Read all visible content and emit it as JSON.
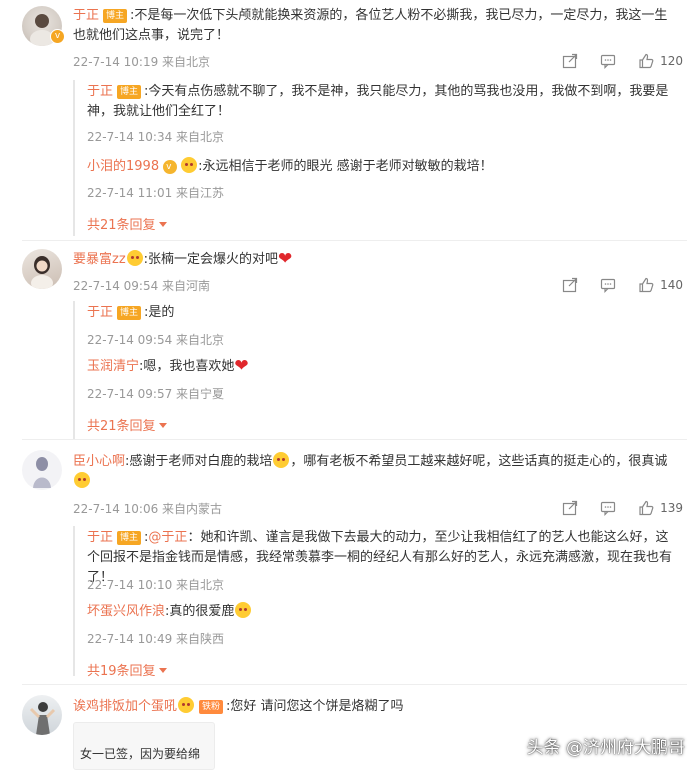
{
  "colors": {
    "accent": "#eb7350",
    "meta": "#999999",
    "badge": "#f6a623"
  },
  "comments": [
    {
      "user": "于正",
      "badge": "博主",
      "text": ":不是每一次低下头颅就能换来资源的，各位艺人粉不必撕我，我已尽力，一定尽力，我这一生也就他们这点事，说完了！",
      "time": "22-7-14 10:19 来自北京",
      "likes": "120",
      "replies": [
        {
          "user": "于正",
          "badge": "博主",
          "text": ":今天有点伤感就不聊了，我不是神，我只能尽力，其他的骂我也没用，我做不到啊，我要是神，我就让他们全红了！",
          "time": "22-7-14 10:34 来自北京"
        },
        {
          "user": "小泪的1998",
          "text": ":永远相信于老师的眼光 感谢于老师对敏敏的栽培！",
          "time": "22-7-14 11:01 来自江苏"
        }
      ],
      "more": "共21条回复"
    },
    {
      "user": "要暴富zz",
      "text": ":张楠一定会爆火的对吧",
      "time": "22-7-14 09:54 来自河南",
      "likes": "140",
      "replies": [
        {
          "user": "于正",
          "badge": "博主",
          "text": ":是的",
          "time": "22-7-14 09:54 来自北京"
        },
        {
          "user": "玉润清宁",
          "text": ":嗯，我也喜欢她",
          "time": "22-7-14 09:57 来自宁夏"
        }
      ],
      "more": "共21条回复"
    },
    {
      "user": "臣小心啊",
      "text": ":感谢于老师对白鹿的栽培",
      "text2": "，哪有老板不希望员工越来越好呢，这些话真的挺走心的，很真诚",
      "time": "22-7-14 10:06 来自内蒙古",
      "likes": "139",
      "replies": [
        {
          "user": "于正",
          "badge": "博主",
          "mention": "@于正",
          "text": "：她和许凯、谨言是我做下去最大的动力，至少让我相信红了的艺人也能这么好，这个回报不是指金钱而是情感，我经常羡慕李一桐的经纪人有那么好的艺人，永远充满感激，现在我也有了！",
          "time": "22-7-14 10:10 来自北京"
        },
        {
          "user": "坏蛋兴风作浪",
          "text": ":真的很爱鹿",
          "time": "22-7-14 10:49 来自陕西"
        }
      ],
      "more": "共19条回复"
    },
    {
      "user": "诶鸡排饭加个蛋吼",
      "badge": "铁粉",
      "text": ":您好 请问您这个饼是烙糊了吗",
      "image_text": "女一已签，因为要给绵"
    }
  ],
  "watermark": "头条 @济州府大鹏哥",
  "icons": {
    "share": "share-icon",
    "comment": "comment-icon",
    "like": "thumb-up-icon"
  }
}
